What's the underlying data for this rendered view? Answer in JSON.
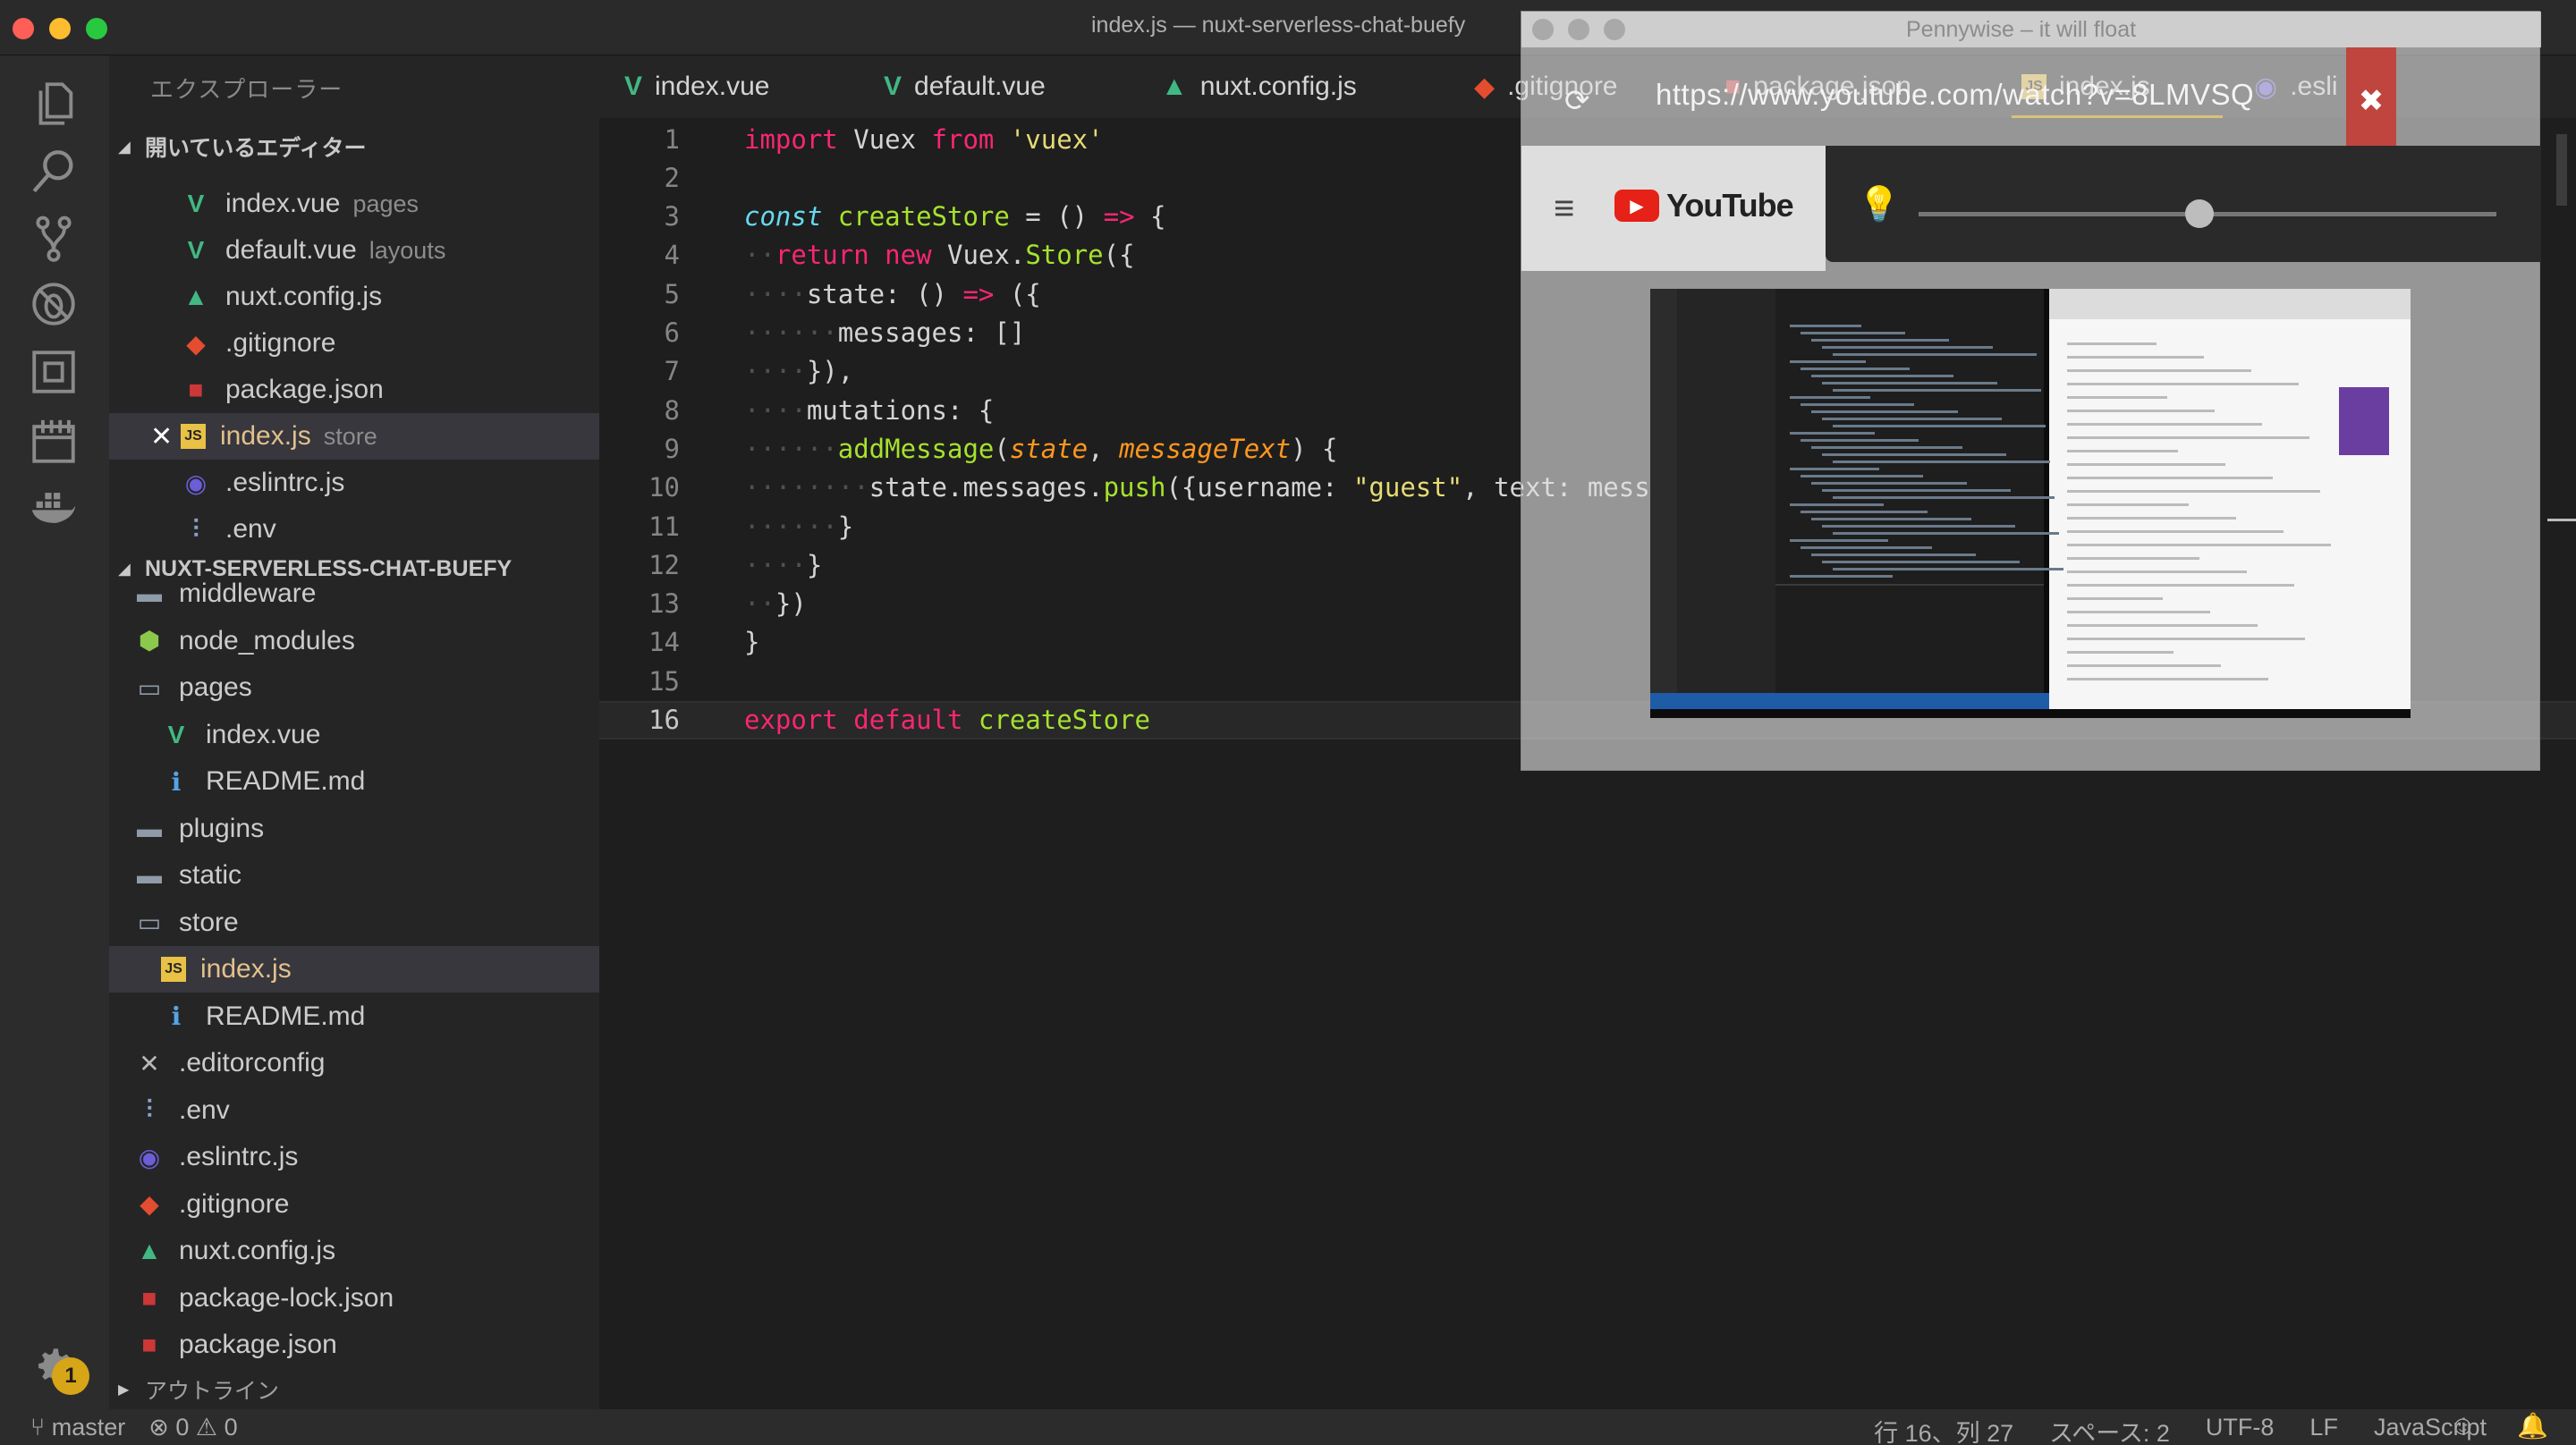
{
  "window": {
    "title": "index.js — nuxt-serverless-chat-buefy"
  },
  "activity_bar": {
    "icons": [
      "files-icon",
      "search-icon",
      "source-control-icon",
      "debug-icon",
      "extensions-icon",
      "calendar-icon",
      "docker-icon",
      "gear-icon"
    ],
    "settings_badge": "1"
  },
  "sidebar": {
    "title": "エクスプローラー",
    "open_editors_label": "開いているエディター",
    "project_label": "NUXT-SERVERLESS-CHAT-BUEFY",
    "outline_label": "アウトライン",
    "open_editors": [
      {
        "name": "index.vue",
        "hint": "pages",
        "icon": "vue-icon"
      },
      {
        "name": "default.vue",
        "hint": "layouts",
        "icon": "vue-icon"
      },
      {
        "name": "nuxt.config.js",
        "hint": "",
        "icon": "nuxt-icon"
      },
      {
        "name": ".gitignore",
        "hint": "",
        "icon": "git-icon"
      },
      {
        "name": "package.json",
        "hint": "",
        "icon": "npm-icon"
      },
      {
        "name": "index.js",
        "hint": "store",
        "icon": "js-icon",
        "active": true,
        "modified": true
      },
      {
        "name": ".eslintrc.js",
        "hint": "",
        "icon": "eslint-icon"
      },
      {
        "name": ".env",
        "hint": "",
        "icon": "env-icon"
      }
    ],
    "project_tree": [
      {
        "name": "middleware",
        "icon": "folder-icon",
        "indent": 0
      },
      {
        "name": "node_modules",
        "icon": "node-folder-icon",
        "indent": 0
      },
      {
        "name": "pages",
        "icon": "folder-open-icon",
        "indent": 0
      },
      {
        "name": "index.vue",
        "icon": "vue-icon",
        "indent": 1
      },
      {
        "name": "README.md",
        "icon": "info-icon",
        "indent": 1
      },
      {
        "name": "plugins",
        "icon": "folder-icon",
        "indent": 0
      },
      {
        "name": "static",
        "icon": "folder-icon",
        "indent": 0
      },
      {
        "name": "store",
        "icon": "folder-open-icon",
        "indent": 0
      },
      {
        "name": "index.js",
        "icon": "js-icon",
        "indent": 1,
        "active": true,
        "modified": true
      },
      {
        "name": "README.md",
        "icon": "info-icon",
        "indent": 1
      },
      {
        "name": ".editorconfig",
        "icon": "tools-icon",
        "indent": 0
      },
      {
        "name": ".env",
        "icon": "env-icon",
        "indent": 0
      },
      {
        "name": ".eslintrc.js",
        "icon": "eslint-icon",
        "indent": 0
      },
      {
        "name": ".gitignore",
        "icon": "git-icon",
        "indent": 0
      },
      {
        "name": "nuxt.config.js",
        "icon": "nuxt-icon",
        "indent": 0
      },
      {
        "name": "package-lock.json",
        "icon": "npm-lock-icon",
        "indent": 0
      },
      {
        "name": "package.json",
        "icon": "npm-icon",
        "indent": 0
      }
    ]
  },
  "editor": {
    "tabs": [
      {
        "name": "index.vue",
        "icon": "vue-icon"
      },
      {
        "name": "default.vue",
        "icon": "vue-icon"
      },
      {
        "name": "nuxt.config.js",
        "icon": "nuxt-icon"
      },
      {
        "name": ".gitignore",
        "icon": "git-icon"
      },
      {
        "name": "package.json",
        "icon": "npm-icon"
      },
      {
        "name": "index.js",
        "icon": "js-icon",
        "active": true
      },
      {
        "name": ".esli",
        "icon": "eslint-icon"
      }
    ],
    "current_line": 16,
    "code_lines": [
      "import Vuex from 'vuex'",
      "",
      "const createStore = () => {",
      "  return new Vuex.Store({",
      "    state: () => ({",
      "      messages: []",
      "    }),",
      "    mutations: {",
      "      addMessage(state, messageText) {",
      "        state.messages.push({username: \"guest\", text: messageText})",
      "      }",
      "    }",
      "  })",
      "}",
      "",
      "export default createStore"
    ]
  },
  "float_window": {
    "title": "Pennywise – it will float",
    "url": "https://www.youtube.com/watch?v=8LMVSQ",
    "site_name": "YouTube"
  },
  "status_bar": {
    "branch": "master",
    "errors": "0",
    "warnings": "0",
    "position": "行 16、列 27",
    "indent": "スペース: 2",
    "encoding": "UTF-8",
    "eol": "LF",
    "language": "JavaScript"
  }
}
